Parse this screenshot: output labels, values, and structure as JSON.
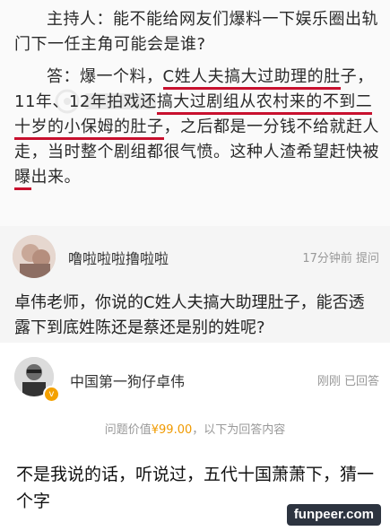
{
  "article": {
    "p1": "主持人：能不能给网友们爆料一下娱乐圈出轨门下一任主角可能会是谁?",
    "p2_start": "答：爆一个料，",
    "p2_u1": "C姓人夫搞大过助理的肚",
    "p2_mid1": "子，11年、12年拍戏还",
    "p2_u2": "搞大过剧组从农村来的",
    "p2_u3": "不到二十岁的小保姆的肚子",
    "p2_mid2": "，之后都是一分钱不给就赶人走，当时整个剧组都很气愤。这种人渣希望赶快被",
    "p2_u4": "曝",
    "p2_end": "出来。"
  },
  "question": {
    "user_name": "噜啦啦啦撸啦啦",
    "time": "17分钟前 提问",
    "text": "卓伟老师，你说的C姓人夫搞大助理肚子，能否透露下到底姓陈还是蔡还是别的姓呢?"
  },
  "answer": {
    "user_name": "中国第一狗仔卓伟",
    "status": "刚刚 已回答",
    "price_label": "问题价值",
    "price_value": "¥99.00",
    "price_suffix": "，以下为回答内容",
    "text": "不是我说的话，听说过，五代十国萧萧下，猜一个字",
    "verified_mark": "v"
  },
  "watermark": {
    "site": "funpeer.com"
  },
  "colors": {
    "underline": "#c8102e",
    "price": "#f09a00",
    "verified": "#f4a100"
  }
}
